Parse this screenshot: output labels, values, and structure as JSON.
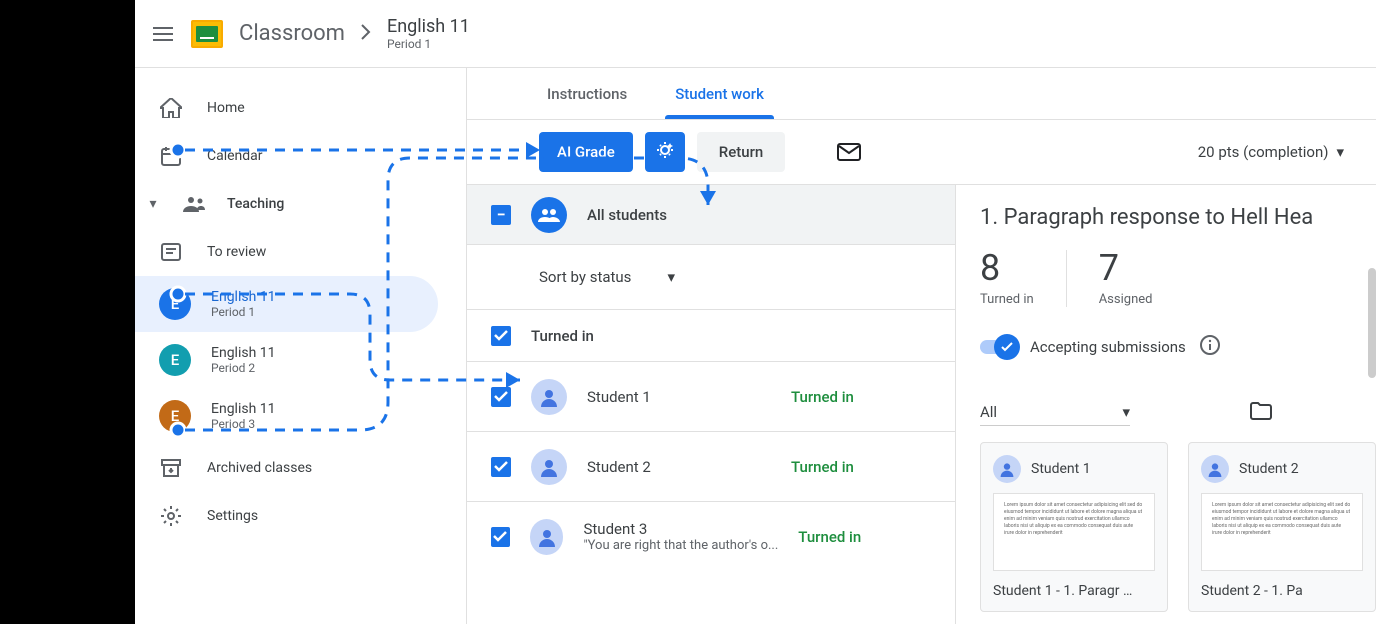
{
  "header": {
    "brand": "Classroom",
    "class_title": "English 11",
    "class_subtitle": "Period 1"
  },
  "sidebar": {
    "home": "Home",
    "calendar": "Calendar",
    "teaching": "Teaching",
    "to_review": "To review",
    "archived": "Archived classes",
    "settings": "Settings",
    "classes": [
      {
        "name": "English 11",
        "period": "Period 1",
        "letter": "E",
        "color": "#1a73e8",
        "selected": true
      },
      {
        "name": "English 11",
        "period": "Period 2",
        "letter": "E",
        "color": "#129eaf",
        "selected": false
      },
      {
        "name": "English 11",
        "period": "Period 3",
        "letter": "E",
        "color": "#c26a17",
        "selected": false
      }
    ]
  },
  "tabs": {
    "instructions": "Instructions",
    "student_work": "Student work"
  },
  "toolbar": {
    "ai_grade": "AI Grade",
    "return": "Return",
    "points": "20 pts (completion)"
  },
  "student_list": {
    "all_students": "All students",
    "sort_by": "Sort by status",
    "turned_in_header": "Turned in",
    "students": [
      {
        "name": "Student 1",
        "status": "Turned in",
        "preview": ""
      },
      {
        "name": "Student 2",
        "status": "Turned in",
        "preview": ""
      },
      {
        "name": "Student 3",
        "status": "Turned in",
        "preview": "\"You are right that the author's o..."
      }
    ]
  },
  "detail": {
    "title": "1.  Paragraph response to Hell Hea",
    "turned_in_count": "8",
    "turned_in_label": "Turned in",
    "assigned_count": "7",
    "assigned_label": "Assigned",
    "accepting": "Accepting submissions",
    "filter_all": "All",
    "cards": [
      {
        "name": "Student 1",
        "doc_title": "Student 1 - 1. Paragr …"
      },
      {
        "name": "Student 2",
        "doc_title": "Student 2 - 1. Pa"
      }
    ]
  }
}
